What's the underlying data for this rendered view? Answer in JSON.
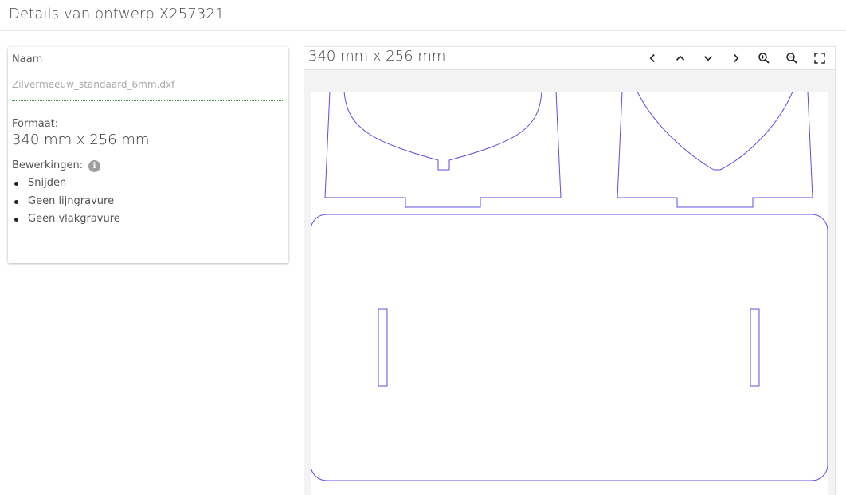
{
  "page": {
    "title": "Details van ontwerp X257321"
  },
  "details": {
    "name_label": "Naam",
    "name_value": "Zilvermeeuw_standaard_6mm.dxf",
    "format_label": "Formaat:",
    "format_value": "340 mm x 256 mm",
    "operations_label": "Bewerkingen:",
    "info_icon": "info-icon",
    "operations": [
      "Snijden",
      "Geen lijngravure",
      "Geen vlakgravure"
    ]
  },
  "preview": {
    "size_label": "340 mm x 256 mm",
    "toolbar": [
      {
        "name": "previous-button",
        "icon": "chevron-left-icon"
      },
      {
        "name": "up-button",
        "icon": "chevron-up-icon"
      },
      {
        "name": "down-button",
        "icon": "chevron-down-icon"
      },
      {
        "name": "next-button",
        "icon": "chevron-right-icon"
      },
      {
        "name": "zoom-in-button",
        "icon": "zoom-in-icon"
      },
      {
        "name": "zoom-out-button",
        "icon": "zoom-out-icon"
      },
      {
        "name": "fullscreen-button",
        "icon": "fullscreen-icon"
      }
    ],
    "line_color": "#5b4fe0"
  },
  "colors": {
    "name_underline": "#3c9a3c",
    "panel_bg": "#f3f3f3"
  }
}
